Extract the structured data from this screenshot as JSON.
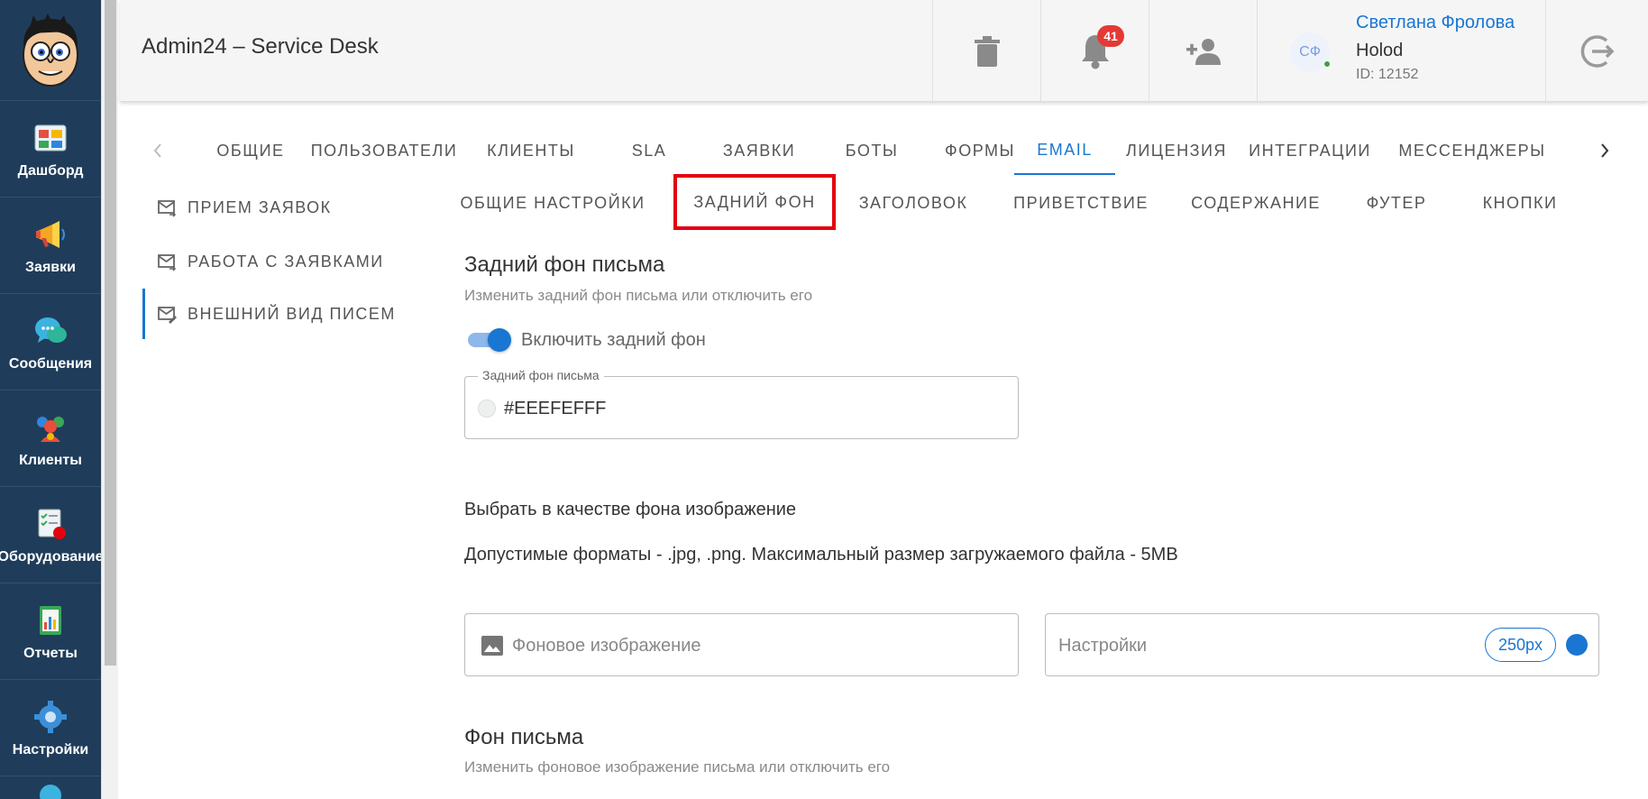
{
  "sidebar": {
    "logo_name": "avatar-logo",
    "items": [
      {
        "label": "Дашборд",
        "icon": "dashboard-icon"
      },
      {
        "label": "Заявки",
        "icon": "megaphone-icon"
      },
      {
        "label": "Сообщения",
        "icon": "chat-bubbles-icon"
      },
      {
        "label": "Клиенты",
        "icon": "clients-icon"
      },
      {
        "label": "Оборудование",
        "icon": "equipment-checklist-icon"
      },
      {
        "label": "Отчеты",
        "icon": "reports-chart-icon"
      },
      {
        "label": "Настройки",
        "icon": "gear-icon"
      }
    ]
  },
  "header": {
    "title": "Admin24 – Service Desk",
    "notifications_count": "41",
    "user": {
      "initials": "СФ",
      "name": "Светлана Фролова",
      "org": "Holod",
      "id": "ID: 12152"
    }
  },
  "tabs": {
    "items": [
      "ОБЩИЕ",
      "ПОЛЬЗОВАТЕЛИ",
      "КЛИЕНТЫ",
      "SLA",
      "ЗАЯВКИ",
      "БОТЫ",
      "ФОРМЫ",
      "EMAIL",
      "ЛИЦЕНЗИЯ",
      "ИНТЕГРАЦИИ",
      "МЕССЕНДЖЕРЫ"
    ],
    "active": "EMAIL"
  },
  "sections": {
    "items": [
      "ПРИЕМ ЗАЯВОК",
      "РАБОТА С ЗАЯВКАМИ",
      "ВНЕШНИЙ ВИД ПИСЕМ"
    ],
    "active": "ВНЕШНИЙ ВИД ПИСЕМ"
  },
  "subtabs": {
    "items": [
      "ОБЩИЕ НАСТРОЙКИ",
      "ЗАДНИЙ ФОН",
      "ЗАГОЛОВОК",
      "ПРИВЕТСТВИЕ",
      "СОДЕРЖАНИЕ",
      "ФУТЕР",
      "КНОПКИ"
    ],
    "highlighted": "ЗАДНИЙ ФОН"
  },
  "content": {
    "bg_title": "Задний фон письма",
    "bg_subtitle": "Изменить задний фон письма или отключить его",
    "bg_toggle_label": "Включить задний фон",
    "bg_toggle_on": true,
    "bg_color_legend": "Задний фон письма",
    "bg_color_value": "#EEEFEFFF",
    "image_title": "Выбрать в качестве фона изображение",
    "image_formats": "Допустимые форматы - .jpg, .png. Максимальный размер загружаемого файла - 5MB",
    "image_placeholder": "Фоновое изображение",
    "settings_placeholder": "Настройки",
    "settings_chip": "250px",
    "letter_bg_title": "Фон письма",
    "letter_bg_subtitle": "Изменить фоновое изображение письма или отключить его"
  },
  "colors": {
    "accent": "#1976d2",
    "sidebar_bg": "#1f3d5a",
    "highlight_border": "#e3000f",
    "badge": "#e53935"
  }
}
